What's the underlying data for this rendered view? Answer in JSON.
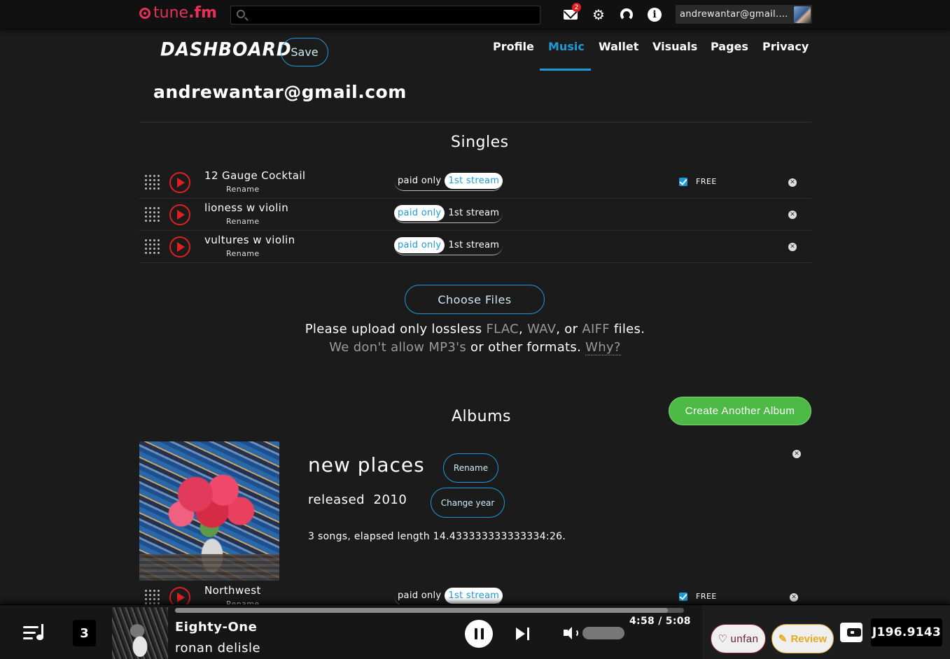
{
  "topbar": {
    "logo_prefix": "tune",
    "logo_suffix": ".fm",
    "search_placeholder": "",
    "mail_count": "2",
    "username": "andrewantar@gmail.com"
  },
  "dashboard": {
    "title": "Dashboard",
    "save_label": "Save",
    "nav": [
      "Profile",
      "Music",
      "Wallet",
      "Visuals",
      "Pages",
      "Privacy"
    ],
    "active_nav": "Music",
    "account_email": "andrewantar@gmail.com"
  },
  "singles": {
    "title": "Singles",
    "rename_label": "Rename",
    "paid_label": "paid only",
    "stream_label": "1st stream",
    "free_label": "FREE",
    "tracks": [
      {
        "name": "12 Gauge Cocktail",
        "mode": "1st stream",
        "free": true
      },
      {
        "name": "lioness w violin",
        "mode": "paid only",
        "free": false
      },
      {
        "name": "vultures w violin",
        "mode": "paid only",
        "free": false
      }
    ]
  },
  "upload": {
    "choose_label": "Choose Files",
    "line1_a": "Please upload only lossless ",
    "fmt1": "FLAC",
    "sep1": ", ",
    "fmt2": "WAV",
    "sep2": ", or ",
    "fmt3": "AIFF",
    "line1_b": " files.",
    "line2_dim": "We don't allow MP3's",
    "line2_b": " or other formats. ",
    "why": "Why?"
  },
  "albums": {
    "title": "Albums",
    "create_label": "Create Another Album",
    "items": [
      {
        "name": "new places",
        "rename_label": "Rename",
        "released_label": "released",
        "year": "2010",
        "change_year_label": "Change year",
        "meta": "3 songs, elapsed length 14.433333333333334:26.",
        "tracks": [
          {
            "name": "Northwest",
            "rename_label": "Rename",
            "mode": "1st stream",
            "free": true
          }
        ]
      }
    ]
  },
  "player": {
    "queue_count": "3",
    "title": "Eighty-One",
    "artist": "ronan delisle",
    "time": "4:58 / 5:08",
    "progress": 0.968,
    "volume": 0.0,
    "unfan_label": "unfan",
    "review_label": "Review",
    "balance": "J196.9143"
  },
  "colors": {
    "accent": "#1e9bd7",
    "brand": "#e8305a",
    "create": "#4cba45",
    "review": "#e8a91c",
    "play": "#e02020"
  }
}
